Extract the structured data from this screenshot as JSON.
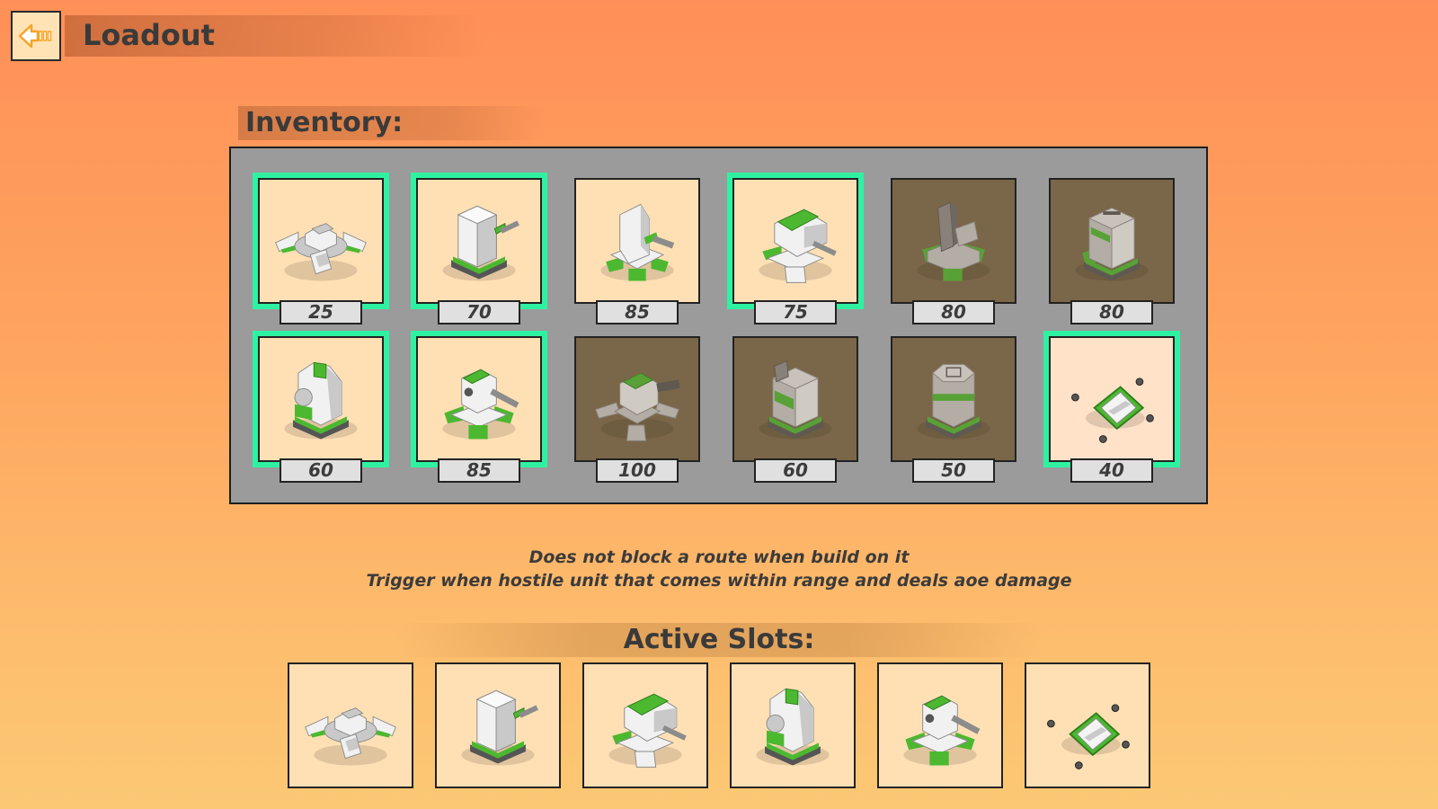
{
  "header": {
    "title": "Loadout",
    "back_icon": "back-arrow-icon"
  },
  "inventory": {
    "heading": "Inventory:",
    "items": [
      {
        "icon": "flat-blaster-turret-icon",
        "price": "25",
        "selected": true,
        "locked": false
      },
      {
        "icon": "cannon-tower-turret-icon",
        "price": "70",
        "selected": true,
        "locked": false
      },
      {
        "icon": "heavy-cannon-turret-icon",
        "price": "85",
        "selected": false,
        "locked": false
      },
      {
        "icon": "twin-cannon-turret-icon",
        "price": "75",
        "selected": true,
        "locked": false
      },
      {
        "icon": "tall-barrier-turret-icon",
        "price": "80",
        "selected": false,
        "locked": true
      },
      {
        "icon": "block-tower-turret-icon",
        "price": "80",
        "selected": false,
        "locked": true
      },
      {
        "icon": "round-cannon-turret-icon",
        "price": "60",
        "selected": true,
        "locked": false
      },
      {
        "icon": "sniper-turret-icon",
        "price": "85",
        "selected": true,
        "locked": false
      },
      {
        "icon": "spider-cannon-turret-icon",
        "price": "100",
        "selected": false,
        "locked": true
      },
      {
        "icon": "box-cannon-turret-icon",
        "price": "60",
        "selected": false,
        "locked": true
      },
      {
        "icon": "octagon-tower-turret-icon",
        "price": "50",
        "selected": false,
        "locked": true
      },
      {
        "icon": "landmine-trap-icon",
        "price": "40",
        "selected": true,
        "locked": false
      }
    ]
  },
  "description": {
    "line1": "Does not block a route when build on it",
    "line2": "Trigger when hostile unit that comes within range and deals aoe damage"
  },
  "active_slots": {
    "heading": "Active Slots:",
    "slots": [
      {
        "icon": "flat-blaster-turret-icon"
      },
      {
        "icon": "cannon-tower-turret-icon"
      },
      {
        "icon": "twin-cannon-turret-icon"
      },
      {
        "icon": "round-cannon-turret-icon"
      },
      {
        "icon": "sniper-turret-icon"
      },
      {
        "icon": "landmine-trap-icon"
      }
    ]
  },
  "colors": {
    "background_top": "#ff8f58",
    "background_bottom": "#fcc874",
    "selected_outline": "#2ef2a2",
    "tile": "#ffe0b4",
    "locked_tile": "#7a6648",
    "panel": "#9b9b9b",
    "turret_green": "#4cb830"
  }
}
